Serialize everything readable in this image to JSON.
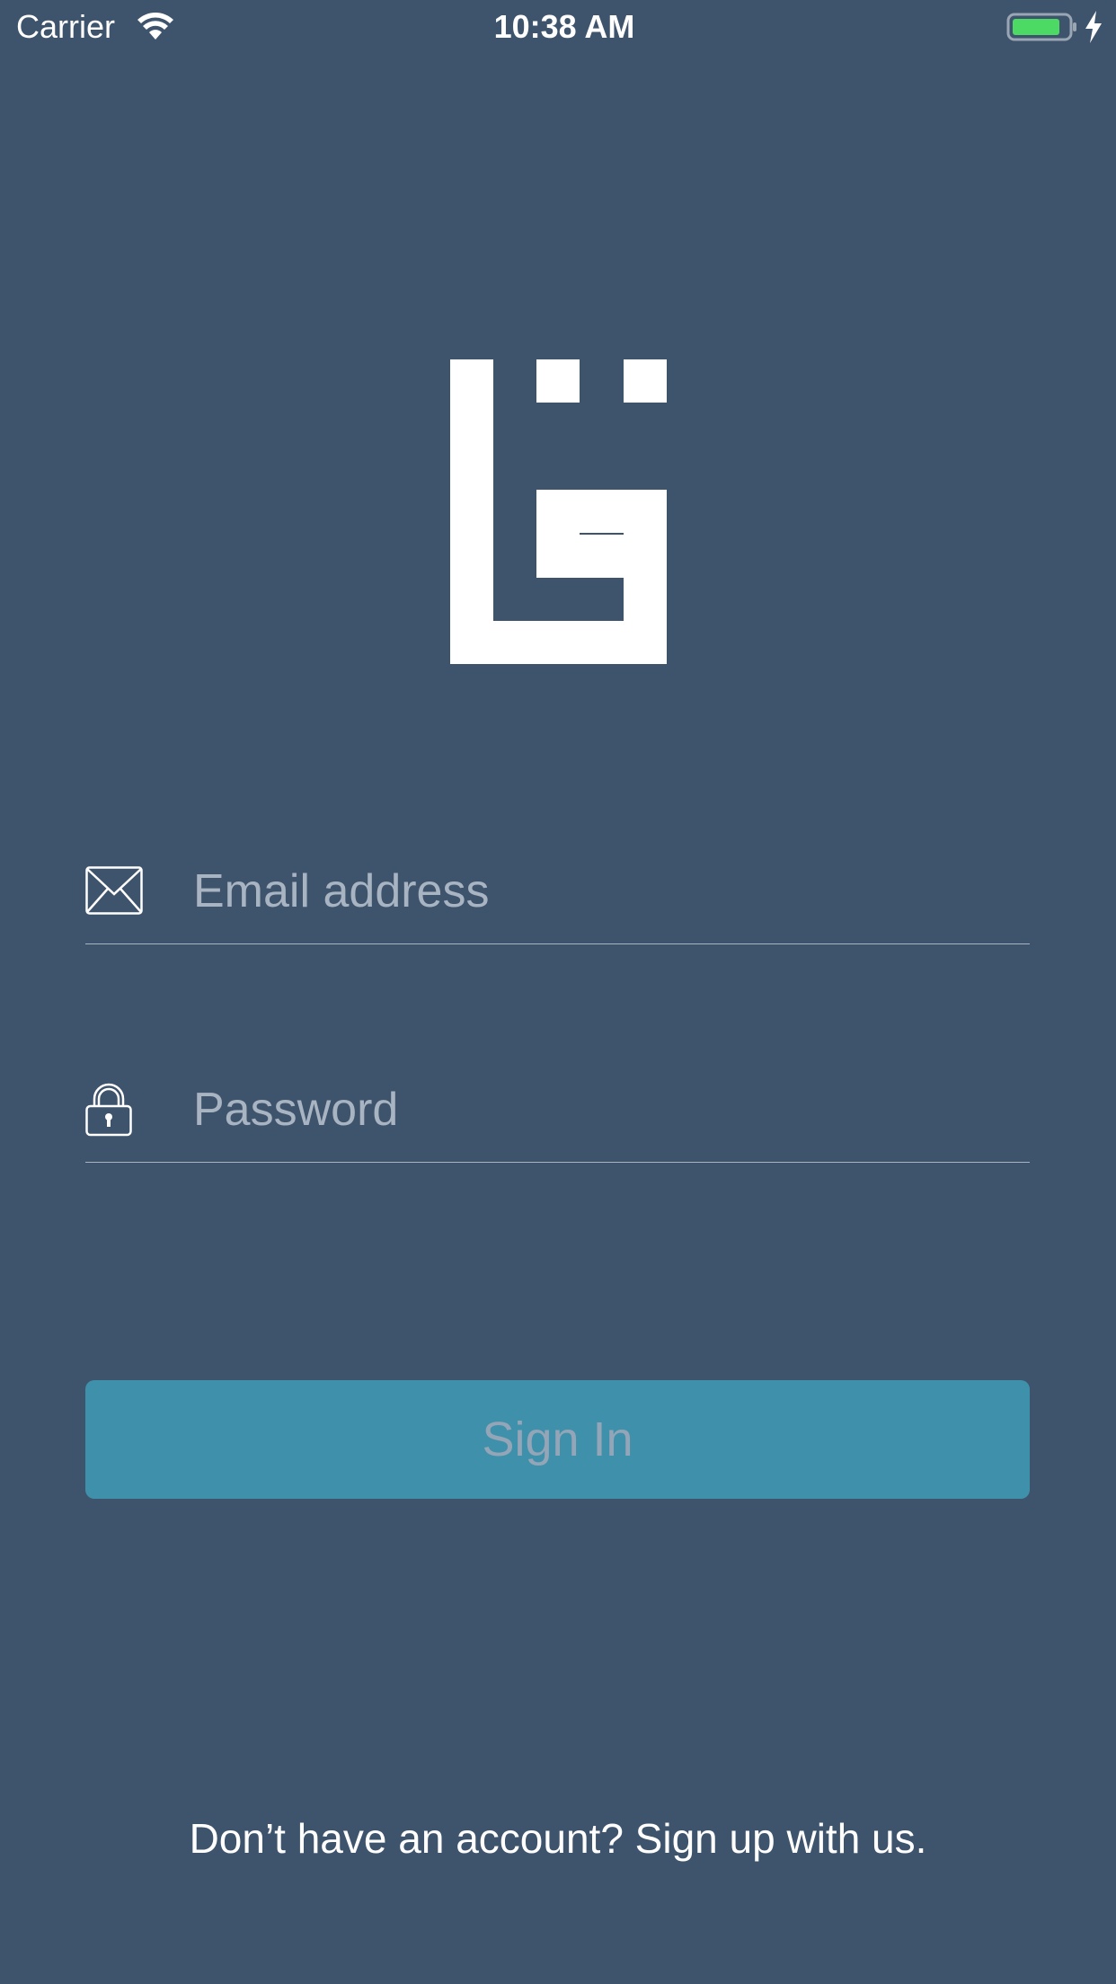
{
  "status_bar": {
    "carrier": "Carrier",
    "time": "10:38 AM",
    "icons": [
      "wifi-icon",
      "battery-icon",
      "charging-bolt-icon"
    ]
  },
  "logo": {
    "icon": "brand-logo-icon"
  },
  "form": {
    "email": {
      "icon": "envelope-icon",
      "placeholder": "Email address",
      "value": ""
    },
    "password": {
      "icon": "lock-icon",
      "placeholder": "Password",
      "value": ""
    },
    "signin_label": "Sign In"
  },
  "signup_text": "Don’t have an account? Sign up with us.",
  "colors": {
    "background": "#3e536c",
    "button": "#3f91ab",
    "button_text_disabled": "#93a5b6",
    "placeholder": "#a8b4c2",
    "battery_fill": "#4cd964"
  }
}
